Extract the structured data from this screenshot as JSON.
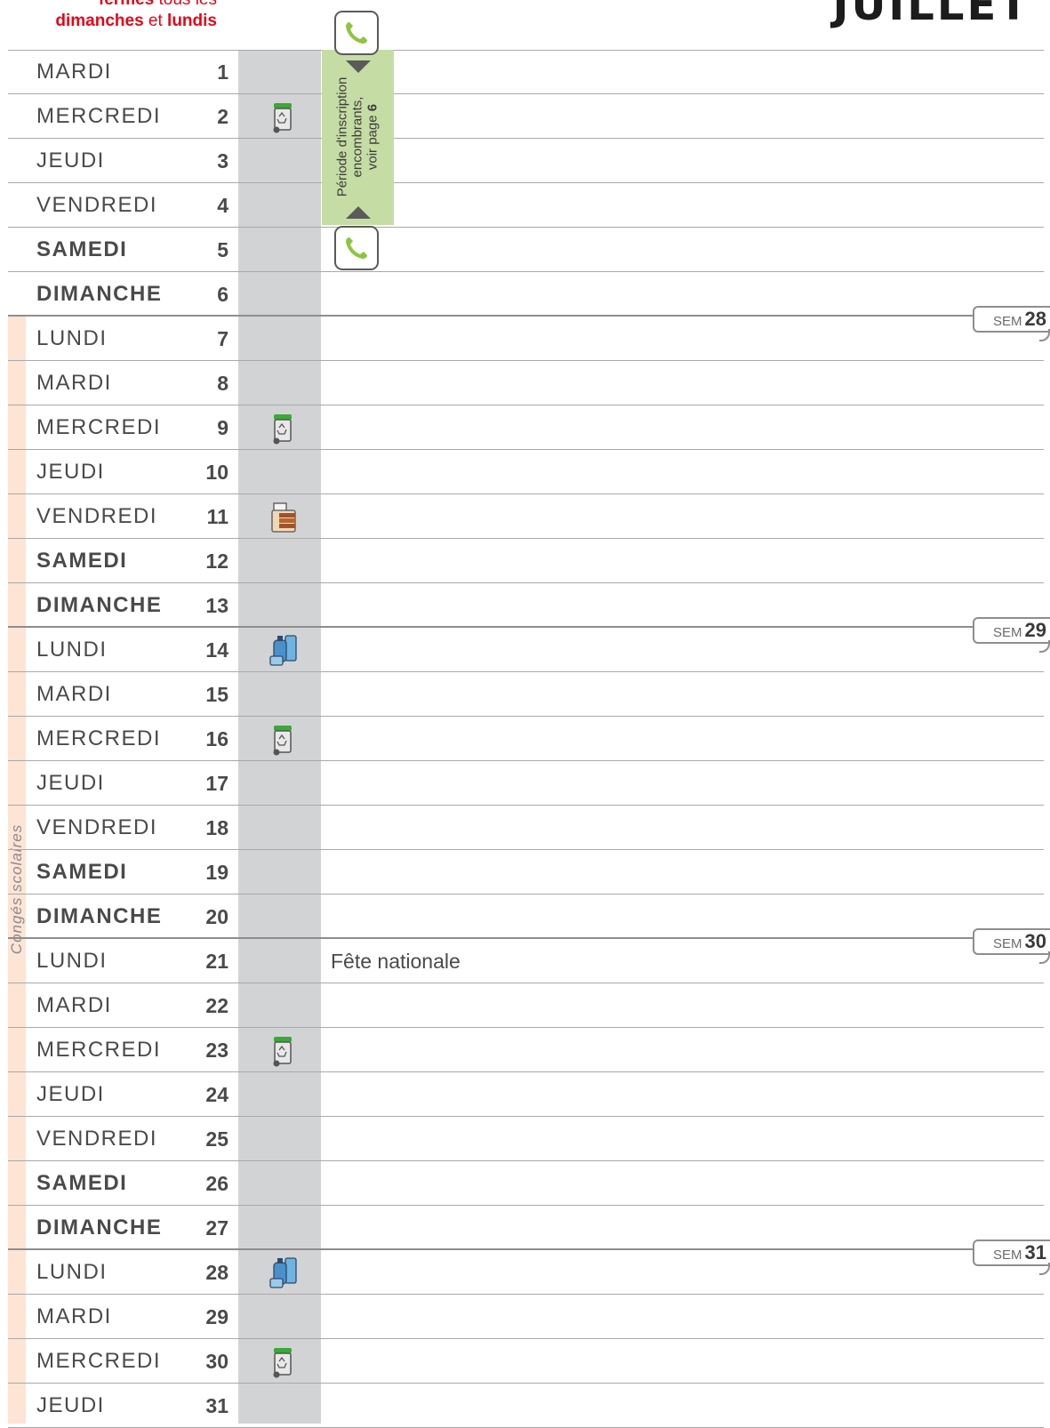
{
  "header": {
    "note_bold": "fermés",
    "note_rest": " tous les",
    "note_line2_a": "dimanches",
    "note_line2_b": " et ",
    "note_line2_c": "lundis",
    "month": "JUILLET"
  },
  "vacation_label": "Congés scolaires",
  "banner": {
    "line1": "Période d'inscription",
    "line2": "encombrants,",
    "line3_text": "voir page ",
    "line3_page": "6"
  },
  "week_tab_prefix": "SEM",
  "weeks": [
    {
      "number": "28"
    },
    {
      "number": "29"
    },
    {
      "number": "30"
    },
    {
      "number": "31"
    }
  ],
  "days": [
    {
      "name": "MARDI",
      "num": "1",
      "weekend": false,
      "icon": "none",
      "note": ""
    },
    {
      "name": "MERCREDI",
      "num": "2",
      "weekend": false,
      "icon": "green-bin",
      "note": ""
    },
    {
      "name": "JEUDI",
      "num": "3",
      "weekend": false,
      "icon": "none",
      "note": ""
    },
    {
      "name": "VENDREDI",
      "num": "4",
      "weekend": false,
      "icon": "none",
      "note": ""
    },
    {
      "name": "SAMEDI",
      "num": "5",
      "weekend": true,
      "icon": "none",
      "note": ""
    },
    {
      "name": "DIMANCHE",
      "num": "6",
      "weekend": true,
      "icon": "none",
      "note": ""
    },
    {
      "name": "LUNDI",
      "num": "7",
      "weekend": false,
      "icon": "none",
      "note": ""
    },
    {
      "name": "MARDI",
      "num": "8",
      "weekend": false,
      "icon": "none",
      "note": ""
    },
    {
      "name": "MERCREDI",
      "num": "9",
      "weekend": false,
      "icon": "green-bin",
      "note": ""
    },
    {
      "name": "JEUDI",
      "num": "10",
      "weekend": false,
      "icon": "none",
      "note": ""
    },
    {
      "name": "VENDREDI",
      "num": "11",
      "weekend": false,
      "icon": "bulky-waste",
      "note": ""
    },
    {
      "name": "SAMEDI",
      "num": "12",
      "weekend": true,
      "icon": "none",
      "note": ""
    },
    {
      "name": "DIMANCHE",
      "num": "13",
      "weekend": true,
      "icon": "none",
      "note": ""
    },
    {
      "name": "LUNDI",
      "num": "14",
      "weekend": false,
      "icon": "blue-recycling",
      "note": ""
    },
    {
      "name": "MARDI",
      "num": "15",
      "weekend": false,
      "icon": "none",
      "note": ""
    },
    {
      "name": "MERCREDI",
      "num": "16",
      "weekend": false,
      "icon": "green-bin",
      "note": ""
    },
    {
      "name": "JEUDI",
      "num": "17",
      "weekend": false,
      "icon": "none",
      "note": ""
    },
    {
      "name": "VENDREDI",
      "num": "18",
      "weekend": false,
      "icon": "none",
      "note": ""
    },
    {
      "name": "SAMEDI",
      "num": "19",
      "weekend": true,
      "icon": "none",
      "note": ""
    },
    {
      "name": "DIMANCHE",
      "num": "20",
      "weekend": true,
      "icon": "none",
      "note": ""
    },
    {
      "name": "LUNDI",
      "num": "21",
      "weekend": false,
      "icon": "none",
      "note": "Fête nationale"
    },
    {
      "name": "MARDI",
      "num": "22",
      "weekend": false,
      "icon": "none",
      "note": ""
    },
    {
      "name": "MERCREDI",
      "num": "23",
      "weekend": false,
      "icon": "green-bin",
      "note": ""
    },
    {
      "name": "JEUDI",
      "num": "24",
      "weekend": false,
      "icon": "none",
      "note": ""
    },
    {
      "name": "VENDREDI",
      "num": "25",
      "weekend": false,
      "icon": "none",
      "note": ""
    },
    {
      "name": "SAMEDI",
      "num": "26",
      "weekend": true,
      "icon": "none",
      "note": ""
    },
    {
      "name": "DIMANCHE",
      "num": "27",
      "weekend": true,
      "icon": "none",
      "note": ""
    },
    {
      "name": "LUNDI",
      "num": "28",
      "weekend": false,
      "icon": "blue-recycling",
      "note": ""
    },
    {
      "name": "MARDI",
      "num": "29",
      "weekend": false,
      "icon": "none",
      "note": ""
    },
    {
      "name": "MERCREDI",
      "num": "30",
      "weekend": false,
      "icon": "green-bin",
      "note": ""
    },
    {
      "name": "JEUDI",
      "num": "31",
      "weekend": false,
      "icon": "none",
      "note": ""
    }
  ],
  "colors": {
    "accent_red": "#e3061a",
    "banner_green": "#c5dda4",
    "phone_green": "#8cc63f",
    "icon_column": "#d2d3d5",
    "vacation_band": "#fde4d5"
  }
}
